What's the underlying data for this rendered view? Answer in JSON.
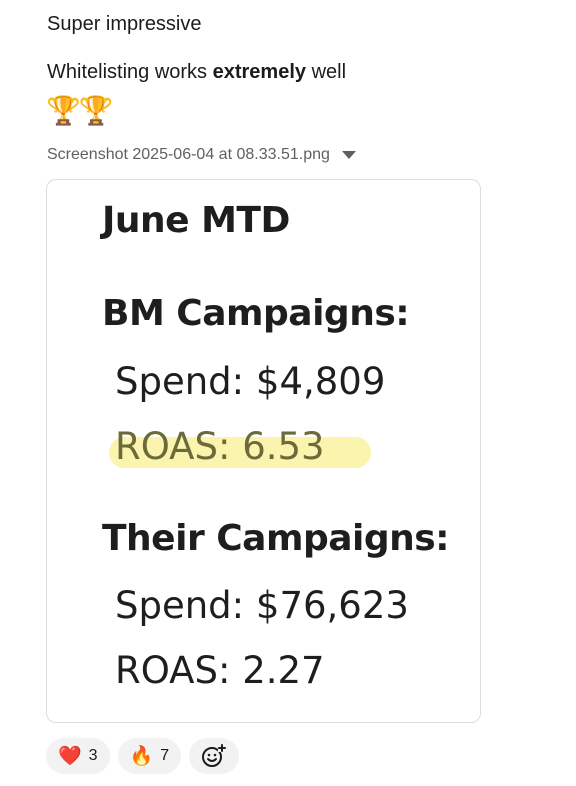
{
  "message": {
    "line1": "Super impressive",
    "line2_before": "Whitelisting works ",
    "line2_bold": "extremely",
    "line2_after": " well",
    "trophies": "🏆🏆"
  },
  "attachment": {
    "filename": "Screenshot 2025-06-04 at 08.33.51.png",
    "caret_icon": "chevron-down-icon",
    "image": {
      "title": "June MTD",
      "bm_heading": "BM Campaigns:",
      "bm_spend": "Spend: $4,809",
      "bm_roas": "ROAS: 6.53",
      "highlight_color": "#fbf3a6",
      "their_heading": "Their Campaigns:",
      "their_spend": "Spend: $76,623",
      "their_roas": "ROAS: 2.27"
    }
  },
  "reactions": [
    {
      "emoji": "❤️",
      "count": "3",
      "icon": "heart-icon"
    },
    {
      "emoji": "🔥",
      "count": "7",
      "icon": "fire-icon"
    }
  ],
  "add_reaction_icon": "add-reaction-icon"
}
